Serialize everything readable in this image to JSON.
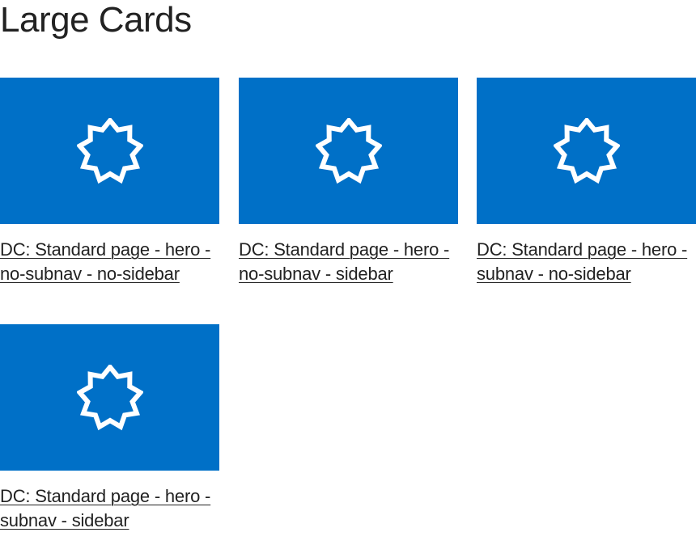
{
  "page": {
    "title": "Large Cards"
  },
  "colors": {
    "card_background": "#0070c7",
    "icon": "#ffffff",
    "text": "#222222"
  },
  "cards": [
    {
      "title": "DC: Standard page - hero - no-subnav - no-sidebar",
      "icon": "nine-pointed-star-icon"
    },
    {
      "title": "DC: Standard page - hero - no-subnav - sidebar",
      "icon": "nine-pointed-star-icon"
    },
    {
      "title": "DC: Standard page - hero - subnav - no-sidebar",
      "icon": "nine-pointed-star-icon"
    },
    {
      "title": "DC: Standard page - hero - subnav - sidebar",
      "icon": "nine-pointed-star-icon"
    }
  ]
}
